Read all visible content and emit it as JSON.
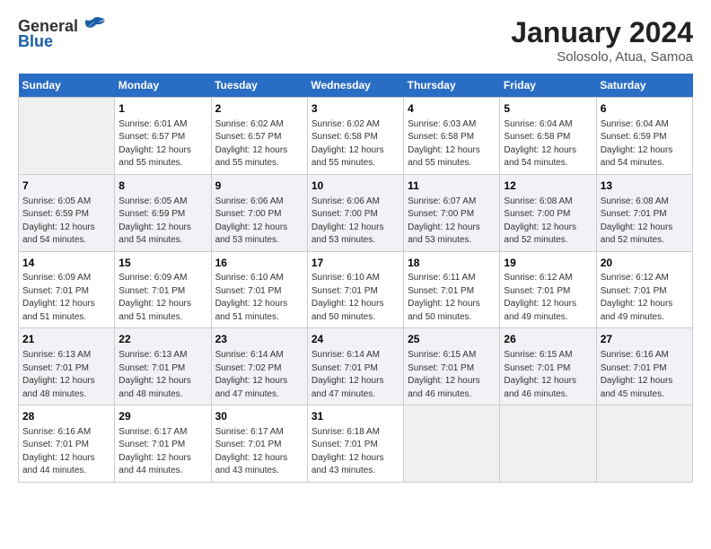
{
  "header": {
    "logo_general": "General",
    "logo_blue": "Blue",
    "title": "January 2024",
    "subtitle": "Solosolo, Atua, Samoa"
  },
  "columns": [
    "Sunday",
    "Monday",
    "Tuesday",
    "Wednesday",
    "Thursday",
    "Friday",
    "Saturday"
  ],
  "weeks": [
    [
      {
        "day": "",
        "sunrise": "",
        "sunset": "",
        "daylight": "",
        "empty": true
      },
      {
        "day": "1",
        "sunrise": "Sunrise: 6:01 AM",
        "sunset": "Sunset: 6:57 PM",
        "daylight": "Daylight: 12 hours and 55 minutes."
      },
      {
        "day": "2",
        "sunrise": "Sunrise: 6:02 AM",
        "sunset": "Sunset: 6:57 PM",
        "daylight": "Daylight: 12 hours and 55 minutes."
      },
      {
        "day": "3",
        "sunrise": "Sunrise: 6:02 AM",
        "sunset": "Sunset: 6:58 PM",
        "daylight": "Daylight: 12 hours and 55 minutes."
      },
      {
        "day": "4",
        "sunrise": "Sunrise: 6:03 AM",
        "sunset": "Sunset: 6:58 PM",
        "daylight": "Daylight: 12 hours and 55 minutes."
      },
      {
        "day": "5",
        "sunrise": "Sunrise: 6:04 AM",
        "sunset": "Sunset: 6:58 PM",
        "daylight": "Daylight: 12 hours and 54 minutes."
      },
      {
        "day": "6",
        "sunrise": "Sunrise: 6:04 AM",
        "sunset": "Sunset: 6:59 PM",
        "daylight": "Daylight: 12 hours and 54 minutes."
      }
    ],
    [
      {
        "day": "7",
        "sunrise": "Sunrise: 6:05 AM",
        "sunset": "Sunset: 6:59 PM",
        "daylight": "Daylight: 12 hours and 54 minutes."
      },
      {
        "day": "8",
        "sunrise": "Sunrise: 6:05 AM",
        "sunset": "Sunset: 6:59 PM",
        "daylight": "Daylight: 12 hours and 54 minutes."
      },
      {
        "day": "9",
        "sunrise": "Sunrise: 6:06 AM",
        "sunset": "Sunset: 7:00 PM",
        "daylight": "Daylight: 12 hours and 53 minutes."
      },
      {
        "day": "10",
        "sunrise": "Sunrise: 6:06 AM",
        "sunset": "Sunset: 7:00 PM",
        "daylight": "Daylight: 12 hours and 53 minutes."
      },
      {
        "day": "11",
        "sunrise": "Sunrise: 6:07 AM",
        "sunset": "Sunset: 7:00 PM",
        "daylight": "Daylight: 12 hours and 53 minutes."
      },
      {
        "day": "12",
        "sunrise": "Sunrise: 6:08 AM",
        "sunset": "Sunset: 7:00 PM",
        "daylight": "Daylight: 12 hours and 52 minutes."
      },
      {
        "day": "13",
        "sunrise": "Sunrise: 6:08 AM",
        "sunset": "Sunset: 7:01 PM",
        "daylight": "Daylight: 12 hours and 52 minutes."
      }
    ],
    [
      {
        "day": "14",
        "sunrise": "Sunrise: 6:09 AM",
        "sunset": "Sunset: 7:01 PM",
        "daylight": "Daylight: 12 hours and 51 minutes."
      },
      {
        "day": "15",
        "sunrise": "Sunrise: 6:09 AM",
        "sunset": "Sunset: 7:01 PM",
        "daylight": "Daylight: 12 hours and 51 minutes."
      },
      {
        "day": "16",
        "sunrise": "Sunrise: 6:10 AM",
        "sunset": "Sunset: 7:01 PM",
        "daylight": "Daylight: 12 hours and 51 minutes."
      },
      {
        "day": "17",
        "sunrise": "Sunrise: 6:10 AM",
        "sunset": "Sunset: 7:01 PM",
        "daylight": "Daylight: 12 hours and 50 minutes."
      },
      {
        "day": "18",
        "sunrise": "Sunrise: 6:11 AM",
        "sunset": "Sunset: 7:01 PM",
        "daylight": "Daylight: 12 hours and 50 minutes."
      },
      {
        "day": "19",
        "sunrise": "Sunrise: 6:12 AM",
        "sunset": "Sunset: 7:01 PM",
        "daylight": "Daylight: 12 hours and 49 minutes."
      },
      {
        "day": "20",
        "sunrise": "Sunrise: 6:12 AM",
        "sunset": "Sunset: 7:01 PM",
        "daylight": "Daylight: 12 hours and 49 minutes."
      }
    ],
    [
      {
        "day": "21",
        "sunrise": "Sunrise: 6:13 AM",
        "sunset": "Sunset: 7:01 PM",
        "daylight": "Daylight: 12 hours and 48 minutes."
      },
      {
        "day": "22",
        "sunrise": "Sunrise: 6:13 AM",
        "sunset": "Sunset: 7:01 PM",
        "daylight": "Daylight: 12 hours and 48 minutes."
      },
      {
        "day": "23",
        "sunrise": "Sunrise: 6:14 AM",
        "sunset": "Sunset: 7:02 PM",
        "daylight": "Daylight: 12 hours and 47 minutes."
      },
      {
        "day": "24",
        "sunrise": "Sunrise: 6:14 AM",
        "sunset": "Sunset: 7:01 PM",
        "daylight": "Daylight: 12 hours and 47 minutes."
      },
      {
        "day": "25",
        "sunrise": "Sunrise: 6:15 AM",
        "sunset": "Sunset: 7:01 PM",
        "daylight": "Daylight: 12 hours and 46 minutes."
      },
      {
        "day": "26",
        "sunrise": "Sunrise: 6:15 AM",
        "sunset": "Sunset: 7:01 PM",
        "daylight": "Daylight: 12 hours and 46 minutes."
      },
      {
        "day": "27",
        "sunrise": "Sunrise: 6:16 AM",
        "sunset": "Sunset: 7:01 PM",
        "daylight": "Daylight: 12 hours and 45 minutes."
      }
    ],
    [
      {
        "day": "28",
        "sunrise": "Sunrise: 6:16 AM",
        "sunset": "Sunset: 7:01 PM",
        "daylight": "Daylight: 12 hours and 44 minutes."
      },
      {
        "day": "29",
        "sunrise": "Sunrise: 6:17 AM",
        "sunset": "Sunset: 7:01 PM",
        "daylight": "Daylight: 12 hours and 44 minutes."
      },
      {
        "day": "30",
        "sunrise": "Sunrise: 6:17 AM",
        "sunset": "Sunset: 7:01 PM",
        "daylight": "Daylight: 12 hours and 43 minutes."
      },
      {
        "day": "31",
        "sunrise": "Sunrise: 6:18 AM",
        "sunset": "Sunset: 7:01 PM",
        "daylight": "Daylight: 12 hours and 43 minutes."
      },
      {
        "day": "",
        "sunrise": "",
        "sunset": "",
        "daylight": "",
        "empty": true
      },
      {
        "day": "",
        "sunrise": "",
        "sunset": "",
        "daylight": "",
        "empty": true
      },
      {
        "day": "",
        "sunrise": "",
        "sunset": "",
        "daylight": "",
        "empty": true
      }
    ]
  ]
}
